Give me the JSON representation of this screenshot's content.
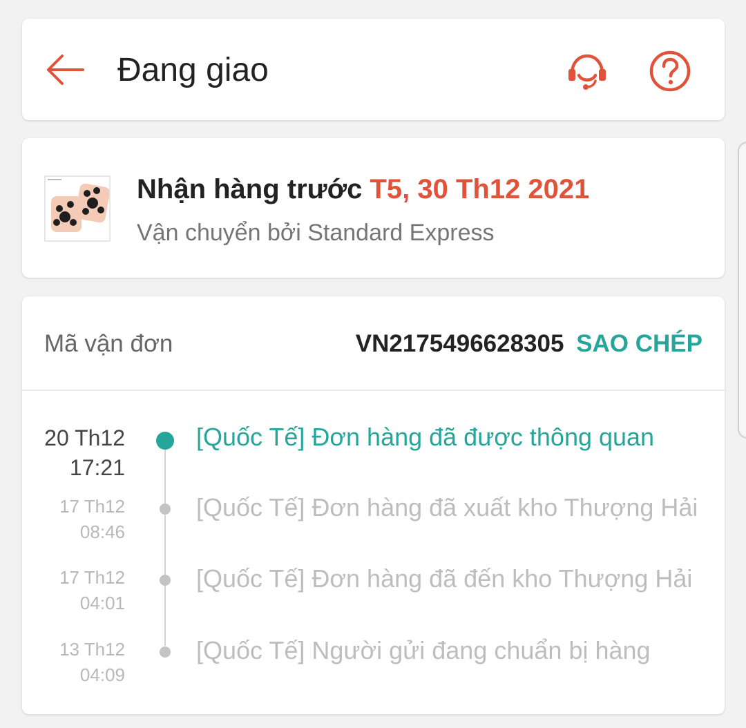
{
  "header": {
    "title": "Đang giao",
    "back_icon": "back-arrow-icon",
    "support_icon": "headset-icon",
    "help_icon": "help-circle-icon",
    "accent_color": "#e0533a"
  },
  "delivery": {
    "eta_label": "Nhận hàng trước",
    "eta_date": "T5, 30 Th12 2021",
    "carrier": "Vận chuyển bởi Standard Express"
  },
  "tracking": {
    "number_label": "Mã vận đơn",
    "number": "VN2175496628305",
    "copy_label": "SAO CHÉP",
    "events": [
      {
        "date": "20 Th12",
        "time": "17:21",
        "text": "[Quốc Tế] Đơn hàng đã được thông quan",
        "active": true
      },
      {
        "date": "17 Th12",
        "time": "08:46",
        "text": "[Quốc Tế] Đơn hàng đã xuất kho Thượng Hải",
        "active": false
      },
      {
        "date": "17 Th12",
        "time": "04:01",
        "text": "[Quốc Tế] Đơn hàng đã đến kho Thượng Hải",
        "active": false
      },
      {
        "date": "13 Th12",
        "time": "04:09",
        "text": "[Quốc Tế] Người gửi đang chuẩn bị hàng",
        "active": false
      }
    ],
    "active_color": "#26a69a"
  }
}
